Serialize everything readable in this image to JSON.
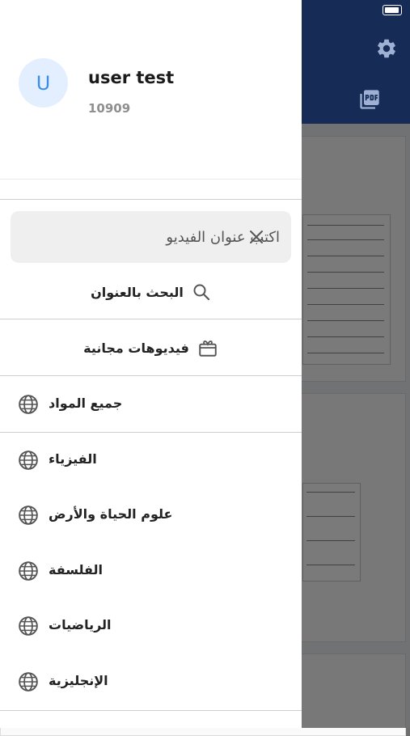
{
  "user": {
    "avatar_initial": "U",
    "name": "user test",
    "id": "10909"
  },
  "search": {
    "placeholder": "اكتب عنوان الفيديو",
    "value": "",
    "button_label": "البحث بالعنوان"
  },
  "free_videos": {
    "label": "فيديوهات مجانية"
  },
  "all_subjects": {
    "label": "جميع المواد"
  },
  "subjects": [
    {
      "label": "الفيزياء"
    },
    {
      "label": "علوم الحياة والأرض"
    },
    {
      "label": "الفلسفة"
    },
    {
      "label": "الرياضيات"
    },
    {
      "label": "الإنجليزية"
    }
  ],
  "icons": {
    "clear": "close-icon",
    "search": "search-icon",
    "free_videos": "gift-icon",
    "subject": "globe-icon",
    "settings": "gear-icon",
    "pdf": "pdf-icon"
  },
  "colors": {
    "header_blue": "#2f5bb5",
    "avatar_bg": "#e3efff",
    "avatar_text": "#3a8ee6"
  }
}
